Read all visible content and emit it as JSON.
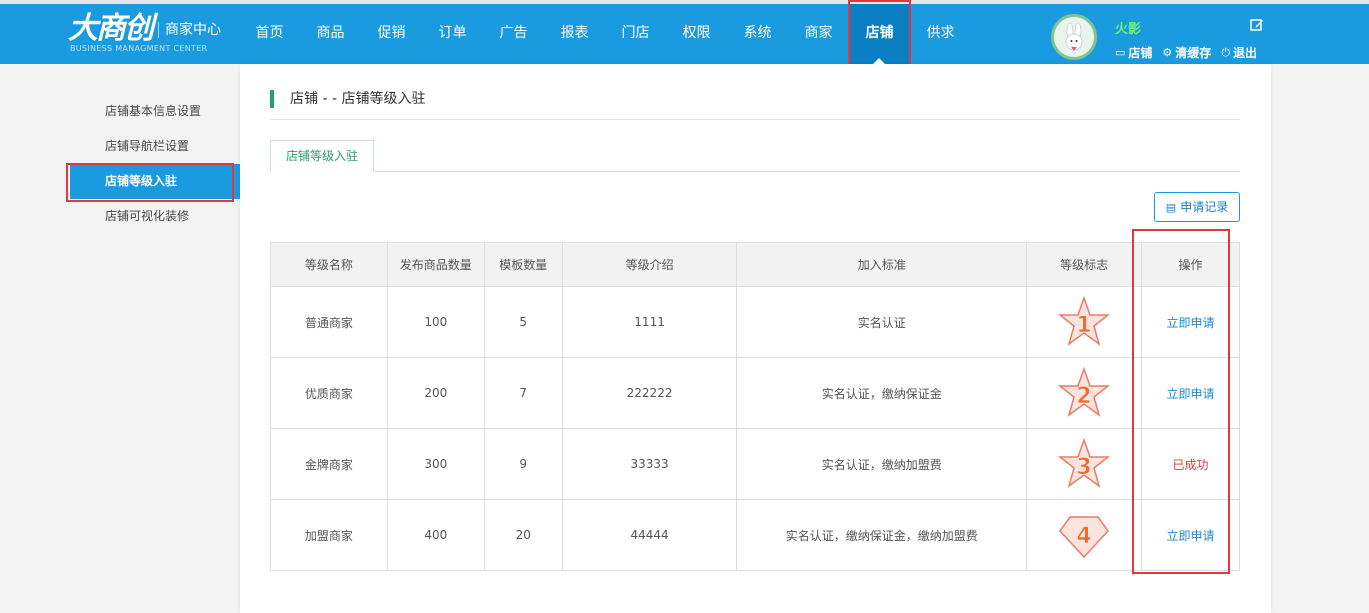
{
  "header": {
    "logo_main": "大商创",
    "logo_sub": "商家中心",
    "logo_en": "BUSINESS MANAGMENT CENTER",
    "nav": [
      "首页",
      "商品",
      "促销",
      "订单",
      "广告",
      "报表",
      "门店",
      "权限",
      "系统",
      "商家",
      "店铺",
      "供求"
    ],
    "active_nav": "店铺",
    "username": "火影",
    "links": {
      "shop": "店铺",
      "clear_cache": "清缓存",
      "logout": "退出"
    }
  },
  "sidebar": {
    "items": [
      {
        "label": "店铺基本信息设置"
      },
      {
        "label": "店铺导航栏设置"
      },
      {
        "label": "店铺等级入驻"
      },
      {
        "label": "店铺可视化装修"
      }
    ],
    "active": "店铺等级入驻"
  },
  "main": {
    "title": "店铺 - - 店铺等级入驻",
    "tab": "店铺等级入驻",
    "record_button": "申请记录",
    "table": {
      "headers": [
        "等级名称",
        "发布商品数量",
        "模板数量",
        "等级介绍",
        "加入标准",
        "等级标志",
        "操作"
      ],
      "rows": [
        {
          "name": "普通商家",
          "goods": "100",
          "templates": "5",
          "intro": "1111",
          "standard": "实名认证",
          "badge": "1",
          "badge_shape": "star",
          "action": "立即申请",
          "action_state": "link"
        },
        {
          "name": "优质商家",
          "goods": "200",
          "templates": "7",
          "intro": "222222",
          "standard": "实名认证，缴纳保证金",
          "badge": "2",
          "badge_shape": "star",
          "action": "立即申请",
          "action_state": "link"
        },
        {
          "name": "金牌商家",
          "goods": "300",
          "templates": "9",
          "intro": "33333",
          "standard": "实名认证，缴纳加盟费",
          "badge": "3",
          "badge_shape": "star",
          "action": "已成功",
          "action_state": "done"
        },
        {
          "name": "加盟商家",
          "goods": "400",
          "templates": "20",
          "intro": "44444",
          "standard": "实名认证，缴纳保证金，缴纳加盟费",
          "badge": "4",
          "badge_shape": "diamond",
          "action": "立即申请",
          "action_state": "link"
        }
      ]
    }
  },
  "colors": {
    "header_blue": "#1b9bdf",
    "accent_green": "#23a06b",
    "link_blue": "#1b88d4",
    "highlight_red": "#e0383e",
    "badge_fill": "#fde3dd",
    "badge_number": "#f26a2e"
  }
}
